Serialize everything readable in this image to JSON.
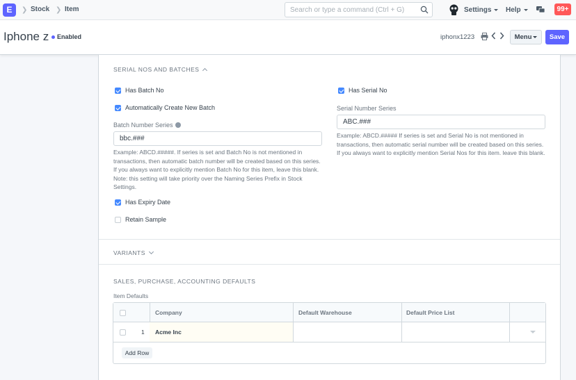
{
  "navbar": {
    "logo_letter": "E",
    "breadcrumbs": [
      "Stock",
      "Item"
    ],
    "search_placeholder": "Search or type a command (Ctrl + G)",
    "settings_label": "Settings",
    "help_label": "Help",
    "notification_count": "99+"
  },
  "header": {
    "title": "Iphone z",
    "status": "Enabled",
    "doc_id": "iphonx1223",
    "menu_label": "Menu",
    "save_label": "Save"
  },
  "serial_batch": {
    "title": "SERIAL NOS AND BATCHES",
    "has_batch_no": {
      "label": "Has Batch No",
      "checked": true
    },
    "auto_create_batch": {
      "label": "Automatically Create New Batch",
      "checked": true
    },
    "batch_series_label": "Batch Number Series",
    "batch_series_value": "bbc.###",
    "batch_help": "Example: ABCD.#####. If series is set and Batch No is not mentioned in transactions, then automatic batch number will be created based on this series. If you always want to explicitly mention Batch No for this item, leave this blank. Note: this setting will take priority over the Naming Series Prefix in Stock Settings.",
    "has_expiry_date": {
      "label": "Has Expiry Date",
      "checked": true
    },
    "retain_sample": {
      "label": "Retain Sample",
      "checked": false
    },
    "has_serial_no": {
      "label": "Has Serial No",
      "checked": true
    },
    "serial_series_label": "Serial Number Series",
    "serial_series_value": "ABC.###",
    "serial_help": "Example: ABCD.##### If series is set and Serial No is not mentioned in transactions, then automatic serial number will be created based on this series. If you always want to explicitly mention Serial Nos for this item. leave this blank."
  },
  "variants": {
    "title": "VARIANTS"
  },
  "defaults": {
    "title": "SALES, PURCHASE, ACCOUNTING DEFAULTS",
    "grid_label": "Item Defaults",
    "columns": [
      "Company",
      "Default Warehouse",
      "Default Price List"
    ],
    "rows": [
      {
        "idx": "1",
        "company": "Acme Inc",
        "warehouse": "",
        "price_list": ""
      }
    ],
    "add_row_label": "Add Row"
  },
  "colors": {
    "primary": "#5e64ff",
    "checkbox": "#4589ff",
    "notification": "#ff5858"
  }
}
